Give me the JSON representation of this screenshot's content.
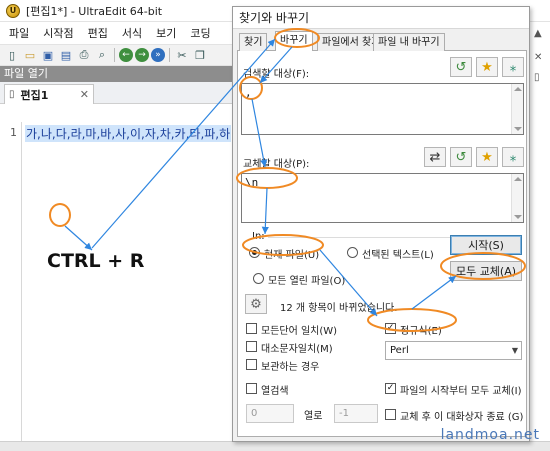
{
  "window": {
    "title": "[편집1*] - UltraEdit 64-bit",
    "logo_letter": "U"
  },
  "menubar": {
    "items": [
      "파일",
      "시작점",
      "편집",
      "서식",
      "보기",
      "코딩"
    ]
  },
  "toolbar": {
    "icons": [
      "new-file-icon",
      "open-folder-icon",
      "save-icon",
      "save-all-icon",
      "print-icon",
      "print-preview-icon",
      "back-icon",
      "forward-icon",
      "next-icon",
      "cut-icon",
      "copy-icon"
    ],
    "glyphs": {
      "new": "▯",
      "open": "▭",
      "save": "▣",
      "save_all": "▤",
      "print": "⎙",
      "preview": "⌕",
      "back": "←",
      "forward": "→",
      "next": "»",
      "cut": "✂",
      "copy": "❐"
    },
    "colors": {
      "back": "#3f8f3f",
      "forward": "#3f8f3f",
      "next": "#2f6fbf"
    }
  },
  "file_panel": {
    "header": "파일 열기"
  },
  "document": {
    "tab_label": "편집1",
    "tab_close": "✕",
    "line_number": "1",
    "content": "가,나,다,라,마,바,사,이,자,차,카,타,파,하"
  },
  "annotation": {
    "shortcut": "CTRL + R",
    "accent_color": "#f08a24",
    "arrow_color": "#2f86e0"
  },
  "dialog": {
    "title": "찾기와 바꾸기",
    "tabs": [
      "찾기",
      "바꾸기",
      "파일에서 찾기",
      "파일 내 바꾸기"
    ],
    "active_tab": "바꾸기",
    "find_label": "검색할 대상(F):",
    "find_value": ",",
    "replace_label": "교체할 대상(P):",
    "replace_value": "\\n",
    "in_label": "In:",
    "scope": {
      "current_file": "현재 파일(U)",
      "selected_text": "선택된 텍스트(L)",
      "all_open_files": "모든 열린 파일(O)",
      "selected": "current_file"
    },
    "buttons": {
      "start": "시작(S)",
      "replace_all": "모두 교체(A)"
    },
    "status_message": "12 개 항목이 바뀌었습니다.",
    "options": {
      "whole_word": {
        "label": "모든단어 일치(W)",
        "checked": false
      },
      "match_case": {
        "label": "대소문자일치(M)",
        "checked": false
      },
      "preserve_case": {
        "label": "보관하는 경우",
        "checked": false
      },
      "column": {
        "label": "열검색",
        "checked": false
      },
      "regex": {
        "label": "정규식(E)",
        "checked": true
      },
      "from_top": {
        "label": "파일의 시작부터 모두 교체(I)",
        "checked": true
      },
      "close_after": {
        "label": "교체 후 이 대화상자 종료 (G)",
        "checked": false
      }
    },
    "regex_engine": "Perl",
    "column_from": "0",
    "column_sep": "열로",
    "column_to": "-1",
    "icon_glyphs": {
      "history": "↺",
      "favorite": "★",
      "special": "⁎",
      "swap": "⇄",
      "settings": "⚙"
    }
  },
  "watermark": "landmoa.net"
}
